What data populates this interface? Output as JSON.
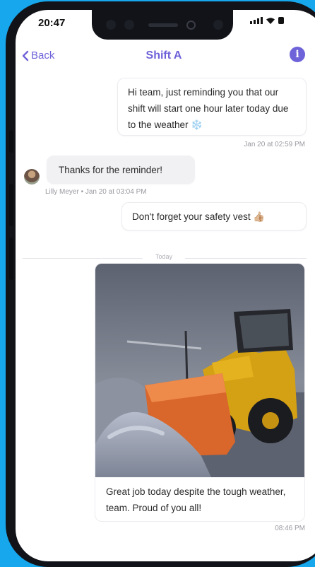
{
  "status_bar": {
    "time": "20:47"
  },
  "nav": {
    "back_label": "Back",
    "title": "Shift A",
    "info_icon": "info-icon",
    "info_glyph": "i"
  },
  "messages": [
    {
      "direction": "outgoing",
      "text": "Hi team, just reminding you that our shift will start one hour later today due to the weather ❄️",
      "meta": "Jan 20 at 02:59 PM"
    },
    {
      "direction": "incoming",
      "text": "Thanks for the reminder!",
      "meta": "Lilly Meyer • Jan 20 at 03:04 PM"
    },
    {
      "direction": "outgoing",
      "text": "Don't forget your safety vest 👍🏼"
    }
  ],
  "divider_label": "Today",
  "image_message": {
    "image": "snowplow-loader-photo",
    "caption": "Great job today despite the tough weather, team. Proud of you all!",
    "meta": "08:46 PM"
  },
  "colors": {
    "accent": "#6e63d8",
    "background": "#17a7ec"
  }
}
